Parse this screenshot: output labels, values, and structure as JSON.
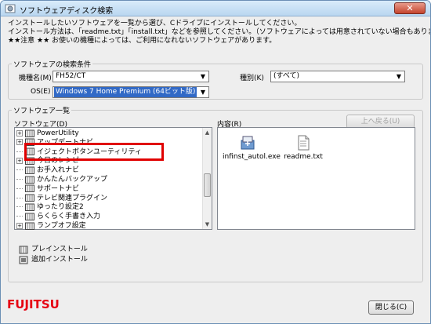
{
  "window": {
    "title": "ソフトウェアディスク検索",
    "close_glyph": "✕"
  },
  "intro": {
    "line1": "インストールしたいソフトウェアを一覧から選び、Cドライブにインストールしてください。",
    "line2": "インストール方法は、「readme.txt」「install.txt」などを参照してください。（ソフトウェアによっては用意されていない場合もあります）",
    "line3": "★★注意 ★★ お使いの機種によっては、ご利用になれないソフトウェアがあります。"
  },
  "search": {
    "group_label": "ソフトウェアの検索条件",
    "model_label": "機種名(M)",
    "model_value": "FH52/CT",
    "type_label": "種別(K)",
    "type_value": "(すべて)",
    "os_label": "OS(E)",
    "os_value": "Windows 7 Home Premium (64ビット版)"
  },
  "list": {
    "group_label": "ソフトウェア一覧",
    "software_label": "ソフトウェア(D)",
    "content_label": "内容(R)",
    "back_button": "上へ戻る(U)",
    "tree_items": [
      {
        "label": "PowerUtility",
        "expand": "+"
      },
      {
        "label": "アップデートナビ",
        "expand": "+"
      },
      {
        "label": "イジェクトボタンユーティリティ",
        "expand": ""
      },
      {
        "label": "今日のレシピ",
        "expand": "+"
      },
      {
        "label": "お手入れナビ",
        "expand": ""
      },
      {
        "label": "かんたんバックアップ",
        "expand": ""
      },
      {
        "label": "サポートナビ",
        "expand": ""
      },
      {
        "label": "テレビ関連プラグイン",
        "expand": ""
      },
      {
        "label": "ゆったり設定2",
        "expand": ""
      },
      {
        "label": "らくらく手書き入力",
        "expand": ""
      },
      {
        "label": "ランプオフ設定",
        "expand": "+"
      }
    ],
    "files": [
      {
        "name": "infinst_autol.exe",
        "icon": "installer-icon"
      },
      {
        "name": "readme.txt",
        "icon": "text-file-icon"
      }
    ]
  },
  "bottom": {
    "preinstall": "プレインストール",
    "addinstall": "追加インストール",
    "close_button": "閉じる(C)",
    "logo": "FUJITSU"
  },
  "colors": {
    "selection": "#3169c6",
    "highlight_box": "#e00000",
    "logo_red": "#e60012"
  }
}
